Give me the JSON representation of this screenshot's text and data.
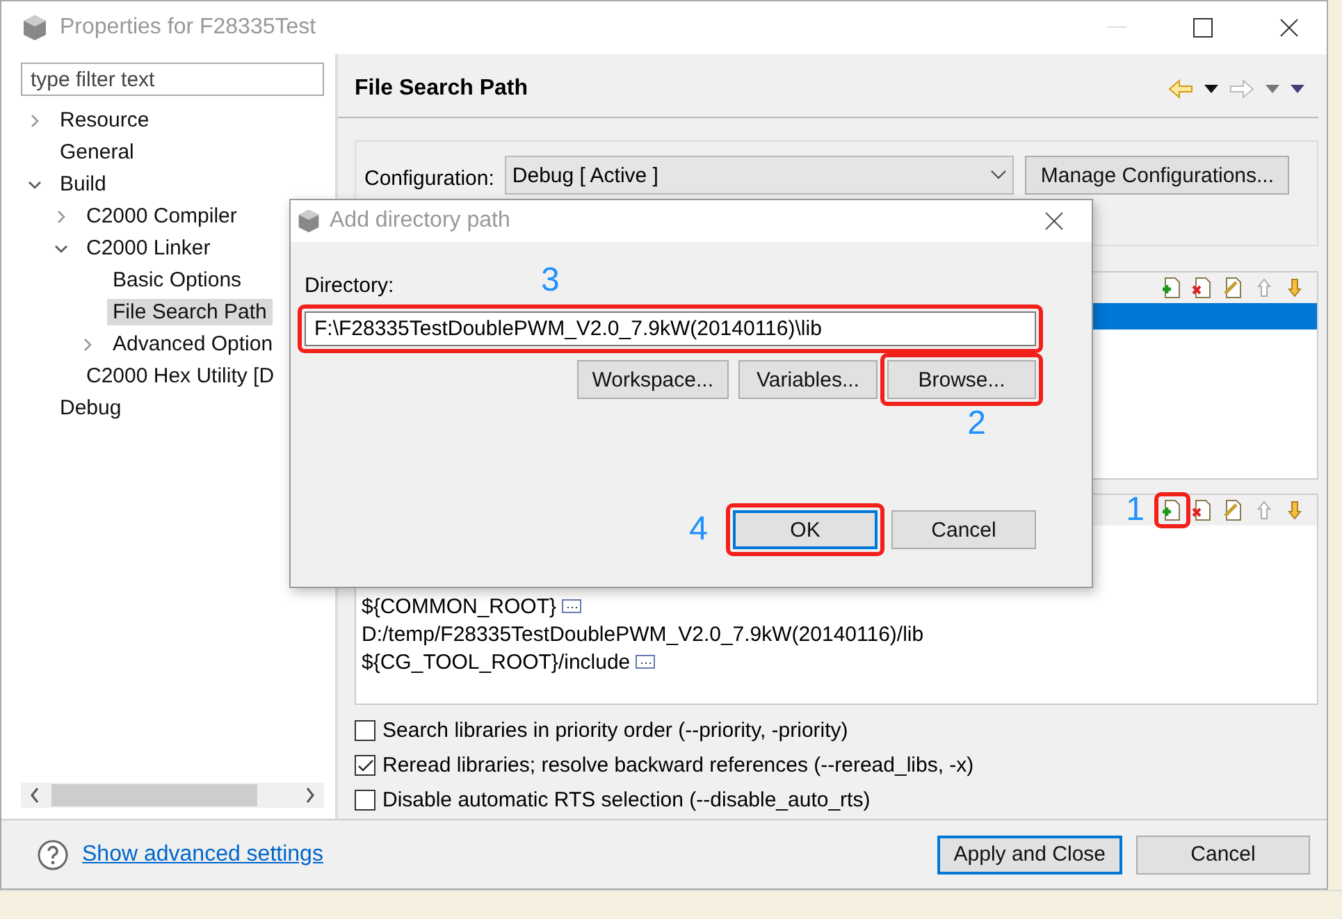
{
  "window": {
    "title": "Properties for F28335Test"
  },
  "filter": {
    "placeholder": "type filter text"
  },
  "tree": [
    {
      "label": "Resource",
      "expanded": false,
      "selected": false
    },
    {
      "label": "General",
      "selected": false
    },
    {
      "label": "Build",
      "expanded": true,
      "selected": false,
      "children": [
        {
          "label": "C2000 Compiler",
          "expanded": false,
          "selected": false
        },
        {
          "label": "C2000 Linker",
          "expanded": true,
          "selected": false,
          "children": [
            {
              "label": "Basic Options",
              "selected": false
            },
            {
              "label": "File Search Path",
              "selected": true
            },
            {
              "label": "Advanced Option",
              "expanded": false,
              "selected": false
            }
          ]
        },
        {
          "label": "C2000 Hex Utility  [D",
          "selected": false
        }
      ]
    },
    {
      "label": "Debug",
      "selected": false
    }
  ],
  "page": {
    "title": "File Search Path"
  },
  "configuration": {
    "label": "Configuration:",
    "value": "Debug  [ Active ]",
    "button": "Manage Configurations..."
  },
  "libraries": {
    "rows": [
      {
        "selected": true
      }
    ]
  },
  "search_paths": {
    "step": "1",
    "add_highlighted": true,
    "items": [
      {
        "text": "${COMMON_ROOT}",
        "kind": "variable"
      },
      {
        "text": "D:/temp/F28335TestDoublePWM_V2.0_7.9kW(20140116)/lib",
        "kind": "path"
      },
      {
        "text": "${CG_TOOL_ROOT}/include",
        "kind": "variable"
      }
    ]
  },
  "options": [
    {
      "label": "Search libraries in priority order (--priority, -priority)",
      "checked": false
    },
    {
      "label": "Reread libraries; resolve backward references (--reread_libs, -x)",
      "checked": true
    },
    {
      "label": "Disable automatic RTS selection (--disable_auto_rts)",
      "checked": false
    }
  ],
  "footer": {
    "link": "Show advanced settings",
    "buttons": [
      {
        "label": "Apply and Close",
        "default": true
      },
      {
        "label": "Cancel",
        "default": false
      }
    ]
  },
  "dialog": {
    "title": "Add directory path",
    "label": "Directory:",
    "step": "3",
    "value": "F:\\F28335TestDoublePWM_V2.0_7.9kW(20140116)\\lib",
    "highlighted": true,
    "buttons": [
      {
        "label": "Workspace...",
        "highlighted": false
      },
      {
        "label": "Variables...",
        "highlighted": false
      },
      {
        "label": "Browse...",
        "highlighted": true,
        "step": "2"
      }
    ],
    "actions": [
      {
        "label": "OK",
        "default": true,
        "highlighted": true,
        "step": "4"
      },
      {
        "label": "Cancel",
        "default": false,
        "highlighted": false
      }
    ]
  }
}
